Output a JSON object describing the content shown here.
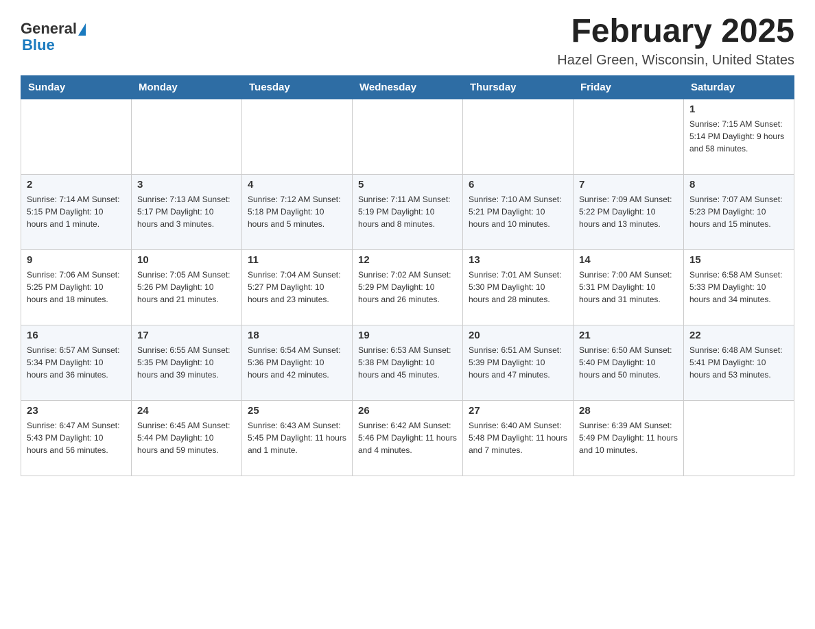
{
  "header": {
    "logo_general": "General",
    "logo_blue": "Blue",
    "month_year": "February 2025",
    "location": "Hazel Green, Wisconsin, United States"
  },
  "days_of_week": [
    "Sunday",
    "Monday",
    "Tuesday",
    "Wednesday",
    "Thursday",
    "Friday",
    "Saturday"
  ],
  "weeks": [
    [
      {
        "day": "",
        "info": ""
      },
      {
        "day": "",
        "info": ""
      },
      {
        "day": "",
        "info": ""
      },
      {
        "day": "",
        "info": ""
      },
      {
        "day": "",
        "info": ""
      },
      {
        "day": "",
        "info": ""
      },
      {
        "day": "1",
        "info": "Sunrise: 7:15 AM\nSunset: 5:14 PM\nDaylight: 9 hours and 58 minutes."
      }
    ],
    [
      {
        "day": "2",
        "info": "Sunrise: 7:14 AM\nSunset: 5:15 PM\nDaylight: 10 hours and 1 minute."
      },
      {
        "day": "3",
        "info": "Sunrise: 7:13 AM\nSunset: 5:17 PM\nDaylight: 10 hours and 3 minutes."
      },
      {
        "day": "4",
        "info": "Sunrise: 7:12 AM\nSunset: 5:18 PM\nDaylight: 10 hours and 5 minutes."
      },
      {
        "day": "5",
        "info": "Sunrise: 7:11 AM\nSunset: 5:19 PM\nDaylight: 10 hours and 8 minutes."
      },
      {
        "day": "6",
        "info": "Sunrise: 7:10 AM\nSunset: 5:21 PM\nDaylight: 10 hours and 10 minutes."
      },
      {
        "day": "7",
        "info": "Sunrise: 7:09 AM\nSunset: 5:22 PM\nDaylight: 10 hours and 13 minutes."
      },
      {
        "day": "8",
        "info": "Sunrise: 7:07 AM\nSunset: 5:23 PM\nDaylight: 10 hours and 15 minutes."
      }
    ],
    [
      {
        "day": "9",
        "info": "Sunrise: 7:06 AM\nSunset: 5:25 PM\nDaylight: 10 hours and 18 minutes."
      },
      {
        "day": "10",
        "info": "Sunrise: 7:05 AM\nSunset: 5:26 PM\nDaylight: 10 hours and 21 minutes."
      },
      {
        "day": "11",
        "info": "Sunrise: 7:04 AM\nSunset: 5:27 PM\nDaylight: 10 hours and 23 minutes."
      },
      {
        "day": "12",
        "info": "Sunrise: 7:02 AM\nSunset: 5:29 PM\nDaylight: 10 hours and 26 minutes."
      },
      {
        "day": "13",
        "info": "Sunrise: 7:01 AM\nSunset: 5:30 PM\nDaylight: 10 hours and 28 minutes."
      },
      {
        "day": "14",
        "info": "Sunrise: 7:00 AM\nSunset: 5:31 PM\nDaylight: 10 hours and 31 minutes."
      },
      {
        "day": "15",
        "info": "Sunrise: 6:58 AM\nSunset: 5:33 PM\nDaylight: 10 hours and 34 minutes."
      }
    ],
    [
      {
        "day": "16",
        "info": "Sunrise: 6:57 AM\nSunset: 5:34 PM\nDaylight: 10 hours and 36 minutes."
      },
      {
        "day": "17",
        "info": "Sunrise: 6:55 AM\nSunset: 5:35 PM\nDaylight: 10 hours and 39 minutes."
      },
      {
        "day": "18",
        "info": "Sunrise: 6:54 AM\nSunset: 5:36 PM\nDaylight: 10 hours and 42 minutes."
      },
      {
        "day": "19",
        "info": "Sunrise: 6:53 AM\nSunset: 5:38 PM\nDaylight: 10 hours and 45 minutes."
      },
      {
        "day": "20",
        "info": "Sunrise: 6:51 AM\nSunset: 5:39 PM\nDaylight: 10 hours and 47 minutes."
      },
      {
        "day": "21",
        "info": "Sunrise: 6:50 AM\nSunset: 5:40 PM\nDaylight: 10 hours and 50 minutes."
      },
      {
        "day": "22",
        "info": "Sunrise: 6:48 AM\nSunset: 5:41 PM\nDaylight: 10 hours and 53 minutes."
      }
    ],
    [
      {
        "day": "23",
        "info": "Sunrise: 6:47 AM\nSunset: 5:43 PM\nDaylight: 10 hours and 56 minutes."
      },
      {
        "day": "24",
        "info": "Sunrise: 6:45 AM\nSunset: 5:44 PM\nDaylight: 10 hours and 59 minutes."
      },
      {
        "day": "25",
        "info": "Sunrise: 6:43 AM\nSunset: 5:45 PM\nDaylight: 11 hours and 1 minute."
      },
      {
        "day": "26",
        "info": "Sunrise: 6:42 AM\nSunset: 5:46 PM\nDaylight: 11 hours and 4 minutes."
      },
      {
        "day": "27",
        "info": "Sunrise: 6:40 AM\nSunset: 5:48 PM\nDaylight: 11 hours and 7 minutes."
      },
      {
        "day": "28",
        "info": "Sunrise: 6:39 AM\nSunset: 5:49 PM\nDaylight: 11 hours and 10 minutes."
      },
      {
        "day": "",
        "info": ""
      }
    ]
  ]
}
